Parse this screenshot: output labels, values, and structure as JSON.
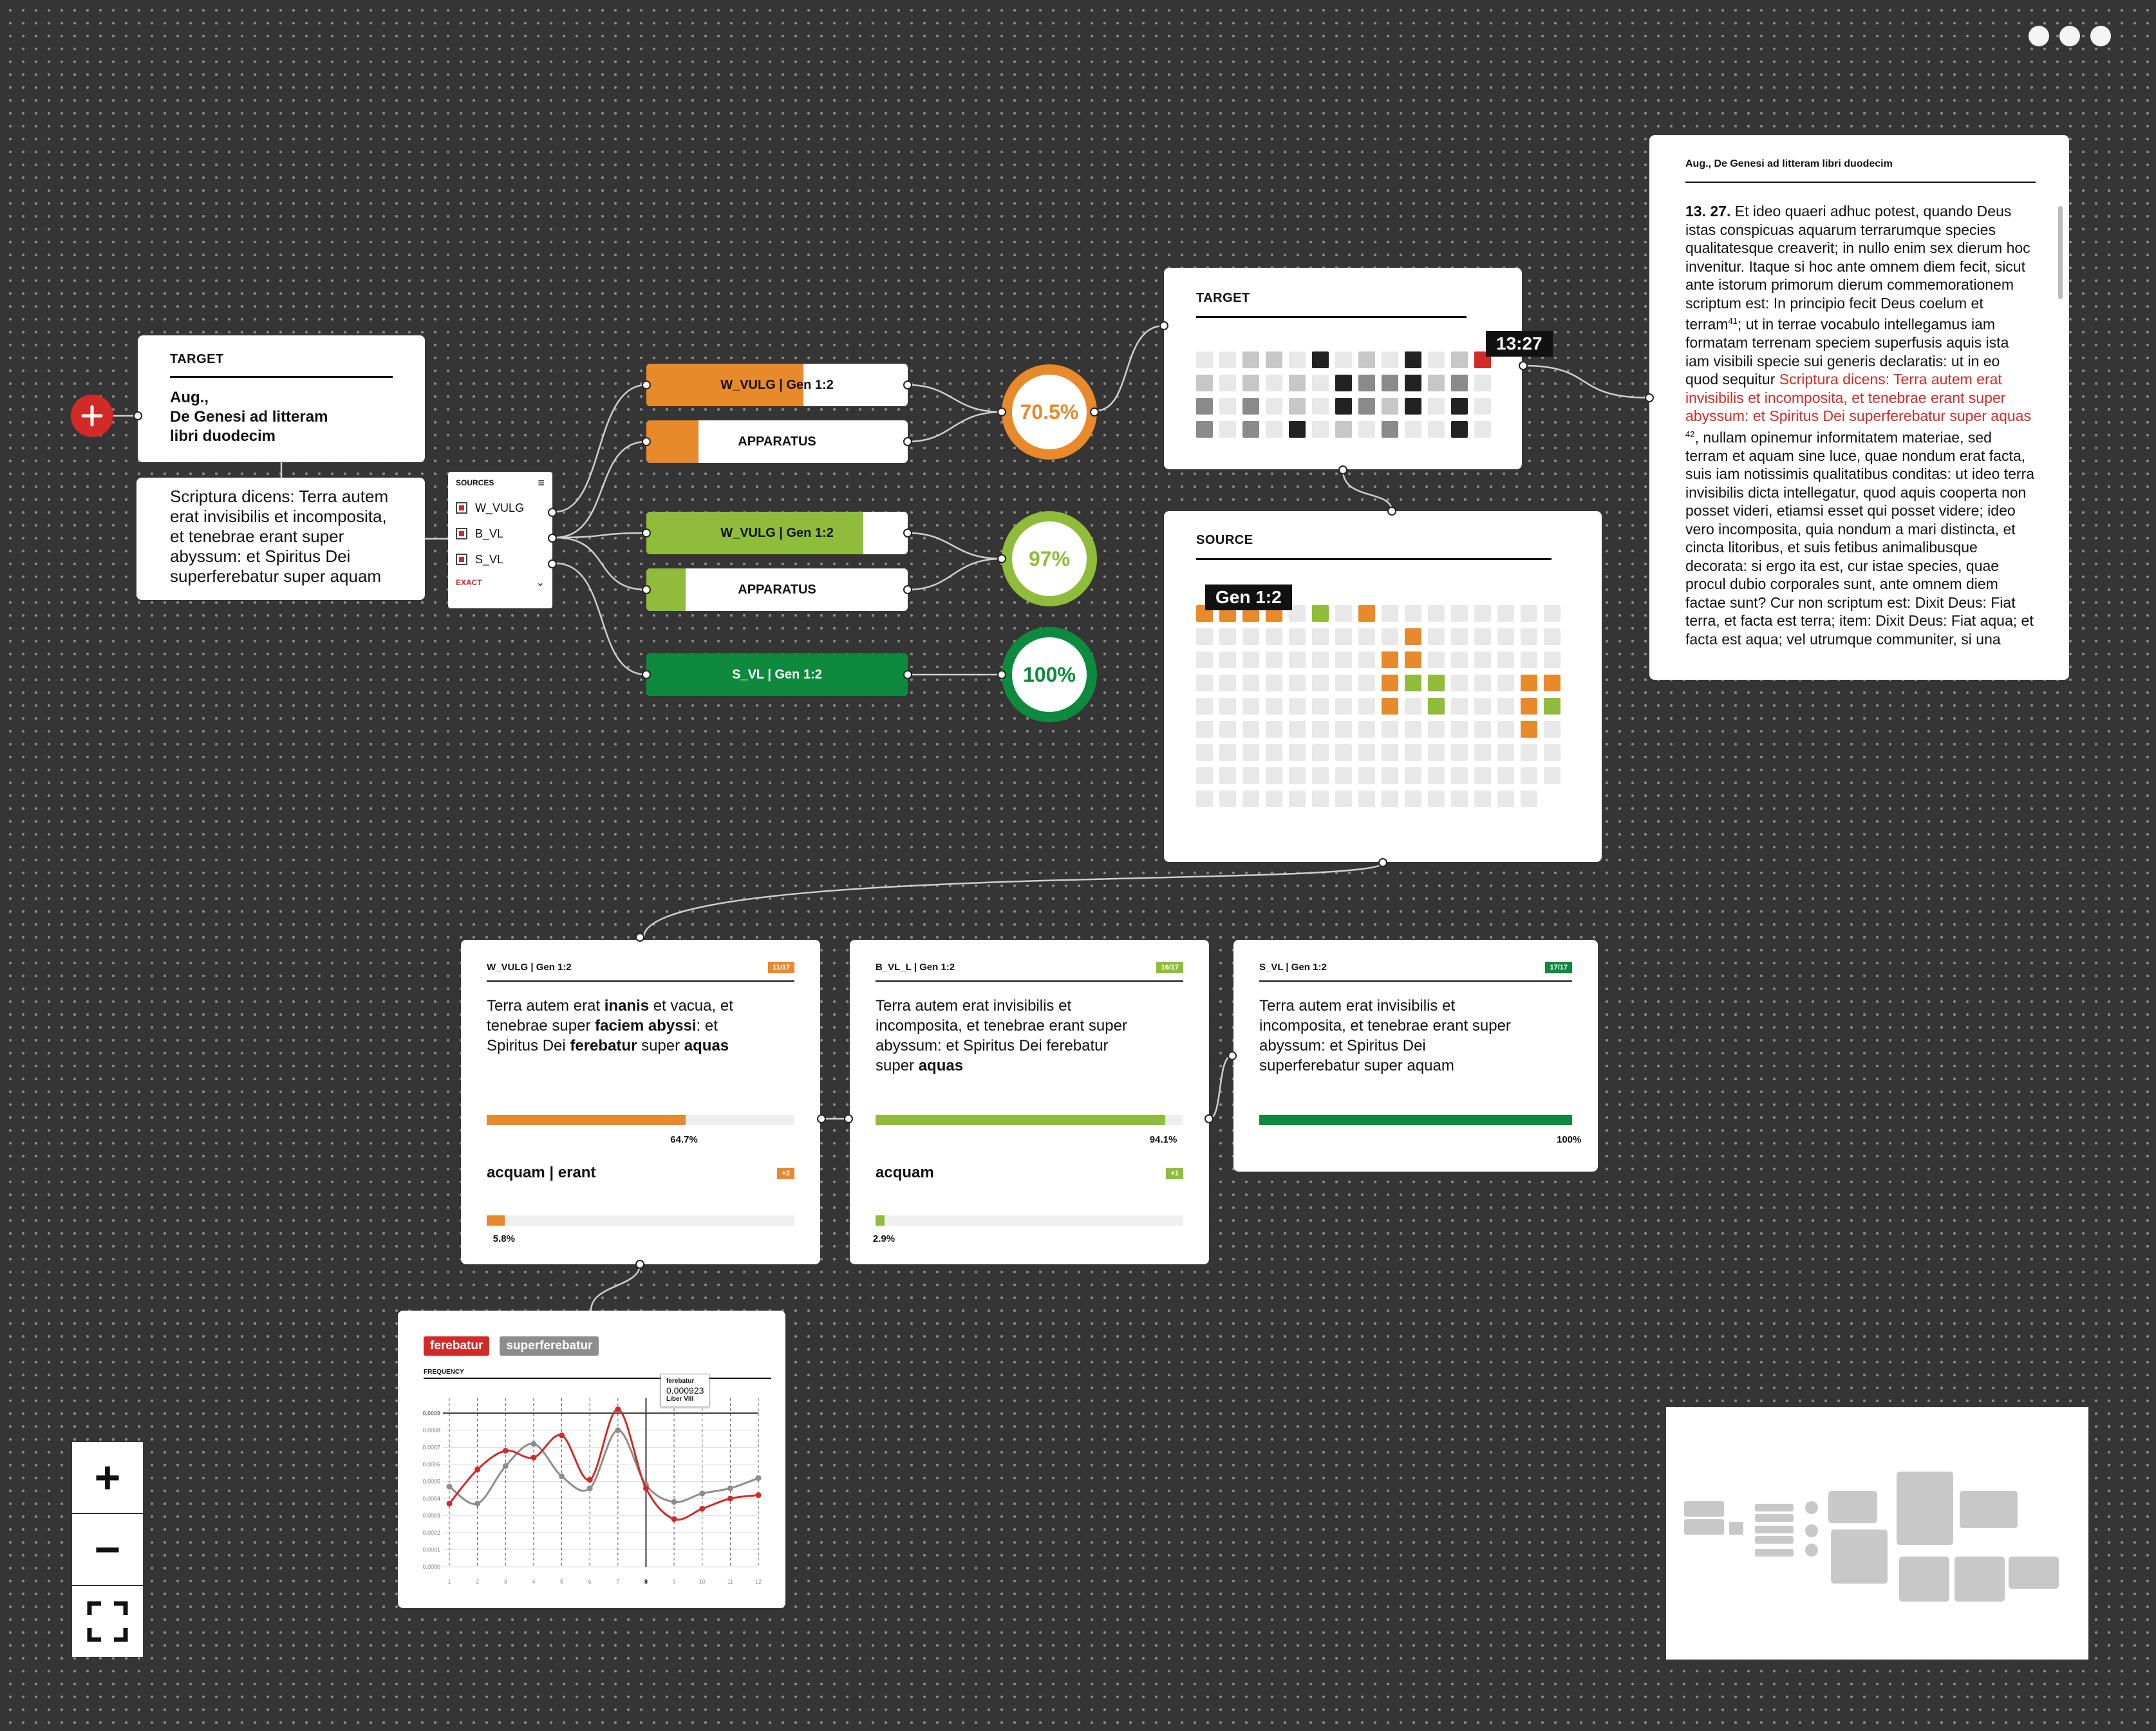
{
  "window": {
    "controls": [
      "dot",
      "dot",
      "dot"
    ]
  },
  "colors": {
    "orange": "#e8892b",
    "light_green": "#8fbc3a",
    "green": "#0e8a3e",
    "red": "#d22a27",
    "dark": "#222222"
  },
  "add_button": {
    "icon": "plus-icon"
  },
  "target_card": {
    "header": "TARGET",
    "title": "Aug.,\nDe Genesi ad litteram\nlibri duodecim",
    "text": "Scriptura dicens: Terra autem erat invisibilis et incomposita, et tenebrae erant super abyssum: et Spiritus Dei superferebatur super aquam"
  },
  "sources_panel": {
    "header": "SOURCES",
    "items": [
      "W_VULG",
      "B_VL",
      "S_VL"
    ],
    "mode": "EXACT"
  },
  "pills": [
    {
      "label": "W_VULG | Gen 1:2",
      "fill": 0.6,
      "color": "#e8892b",
      "text_color": "#111"
    },
    {
      "label": "APPARATUS",
      "fill": 0.2,
      "color": "#e8892b",
      "text_color": "#111"
    },
    {
      "label": "W_VULG | Gen 1:2",
      "fill": 0.83,
      "color": "#8fbc3a",
      "text_color": "#111"
    },
    {
      "label": "APPARATUS",
      "fill": 0.15,
      "color": "#8fbc3a",
      "text_color": "#111"
    },
    {
      "label": "S_VL | Gen 1:2",
      "fill": 1.0,
      "color": "#0e8a3e",
      "text_color": "#fff"
    }
  ],
  "scores": [
    {
      "value": "70.5%",
      "color": "#e8892b"
    },
    {
      "value": "97%",
      "color": "#8fbc3a"
    },
    {
      "value": "100%",
      "color": "#0e8a3e"
    }
  ],
  "target_grid": {
    "header": "TARGET",
    "tooltip": "13:27",
    "rows": [
      [
        0,
        0,
        1,
        1,
        0,
        3,
        0,
        1,
        0,
        3,
        0,
        1,
        0
      ],
      [
        1,
        0,
        1,
        0,
        1,
        0,
        3,
        2,
        2,
        3,
        1,
        2,
        0
      ],
      [
        2,
        0,
        2,
        0,
        1,
        0,
        3,
        2,
        1,
        3,
        0,
        3,
        0
      ],
      [
        2,
        0,
        2,
        0,
        3,
        0,
        1,
        0,
        2,
        0,
        0,
        3,
        0
      ]
    ],
    "highlight": {
      "row": 0,
      "col": 12,
      "color": "#d22a27"
    }
  },
  "source_grid": {
    "header": "SOURCE",
    "tooltip": "Gen 1:2"
  },
  "reading_panel": {
    "title": "Aug., De Genesi ad litteram libri duodecim",
    "ref": "13. 27.",
    "text_before": "Et ideo quaeri adhuc potest, quando Deus istas conspicuas aquarum terrarumque species qualitatesque creaverit; in nullo enim sex dierum hoc invenitur. Itaque si hoc ante omnem diem fecit, sicut ante istorum primorum dierum commemorationem scriptum est: In principio fecit Deus coelum et terram",
    "note1": "41",
    "text_mid": "; ut in terrae vocabulo intellegamus iam formatam terrenam speciem superfusis aquis ista iam visibili specie sui generis declaratis: ut in eo quod sequitur",
    "highlight": "Scriptura dicens: Terra autem erat invisibilis et incomposita, et tenebrae erant super abyssum: et Spiritus Dei superferebatur super aquas",
    "note2": "42",
    "text_after": ", nullam opinemur informitatem materiae, sed terram et aquam sine luce, quae nondum erat facta, suis iam notissimis qualitatibus conditas: ut ideo terra invisibilis dicta intellegatur, quod aquis cooperta non posset videri, etiamsi esset qui posset videre; ideo vero incomposita, quia nondum a mari distincta, et cincta litoribus, et suis fetibus animalibusque decorata: si ergo ita est, cur istae species, quae procul dubio corporales sunt, ante omnem diem factae sunt? Cur non scriptum est: Dixit Deus: Fiat terra, et facta est terra; item: Dixit Deus: Fiat aqua; et facta est aqua; vel utrumque communiter, si una"
  },
  "comparisons": [
    {
      "title": "W_VULG | Gen 1:2",
      "badge": "11/17",
      "color": "#e8892b",
      "segments": [
        [
          "Terra autem erat ",
          0
        ],
        [
          "inanis",
          1
        ],
        [
          " et vacua, et tenebrae super ",
          0
        ],
        [
          "faciem abyssi",
          1
        ],
        [
          ": et Spiritus Dei ",
          0
        ],
        [
          "ferebatur",
          1
        ],
        [
          " super ",
          0
        ],
        [
          "aquas",
          1
        ]
      ],
      "match": 0.647,
      "match_label": "64.7%",
      "variant": "acquam | erant",
      "variant_badge": "+2",
      "variant_share": 0.058,
      "variant_label": "5.8%"
    },
    {
      "title": "B_VL_L | Gen 1:2",
      "badge": "16/17",
      "color": "#8fbc3a",
      "segments": [
        [
          "Terra autem erat invisibilis et incomposita, et tenebrae erant super abyssum: et Spiritus Dei ferebatur super ",
          0
        ],
        [
          "aquas",
          1
        ]
      ],
      "match": 0.941,
      "match_label": "94.1%",
      "variant": "acquam",
      "variant_badge": "+1",
      "variant_share": 0.029,
      "variant_label": "2.9%"
    },
    {
      "title": "S_VL | Gen 1:2",
      "badge": "17/17",
      "color": "#0e8a3e",
      "segments": [
        [
          "Terra autem erat invisibilis et incomposita, et tenebrae erant super abyssum: et Spiritus Dei superferebatur super aquam",
          0
        ]
      ],
      "match": 1.0,
      "match_label": "100%"
    }
  ],
  "frequency": {
    "tags": [
      {
        "label": "ferebatur",
        "color": "#d22a27"
      },
      {
        "label": "superferebatur",
        "color": "#8d8d8d"
      }
    ],
    "axis_title": "FREQUENCY",
    "tooltip": {
      "word": "ferebatur",
      "value": "0.000923",
      "book": "Liber VIII"
    }
  },
  "chart_data": {
    "type": "line",
    "title": "",
    "ylabel": "FREQUENCY",
    "x": [
      1,
      2,
      3,
      4,
      5,
      6,
      7,
      8,
      9,
      10,
      11,
      12
    ],
    "y_ticks": [
      "0.0009",
      "0.0008",
      "0.0007",
      "0.0006",
      "0.0005",
      "0.0004",
      "0.0003",
      "0.0002",
      "0.0001",
      "0.0000"
    ],
    "ylim": [
      0,
      0.00095
    ],
    "series": [
      {
        "name": "ferebatur",
        "color": "#d22a27",
        "values": [
          0.00037,
          0.00057,
          0.00068,
          0.00064,
          0.00077,
          0.00051,
          0.000923,
          0.00046,
          0.00028,
          0.00034,
          0.0004,
          0.00042
        ]
      },
      {
        "name": "superferebatur",
        "color": "#8d8d8d",
        "values": [
          0.00047,
          0.00037,
          0.00059,
          0.00072,
          0.00053,
          0.00046,
          0.0008,
          0.00048,
          0.00038,
          0.00043,
          0.00046,
          0.00052
        ]
      }
    ],
    "highlight_x": 8
  },
  "zoom": {
    "in": "+",
    "out": "−",
    "fit": "fullscreen-icon"
  }
}
